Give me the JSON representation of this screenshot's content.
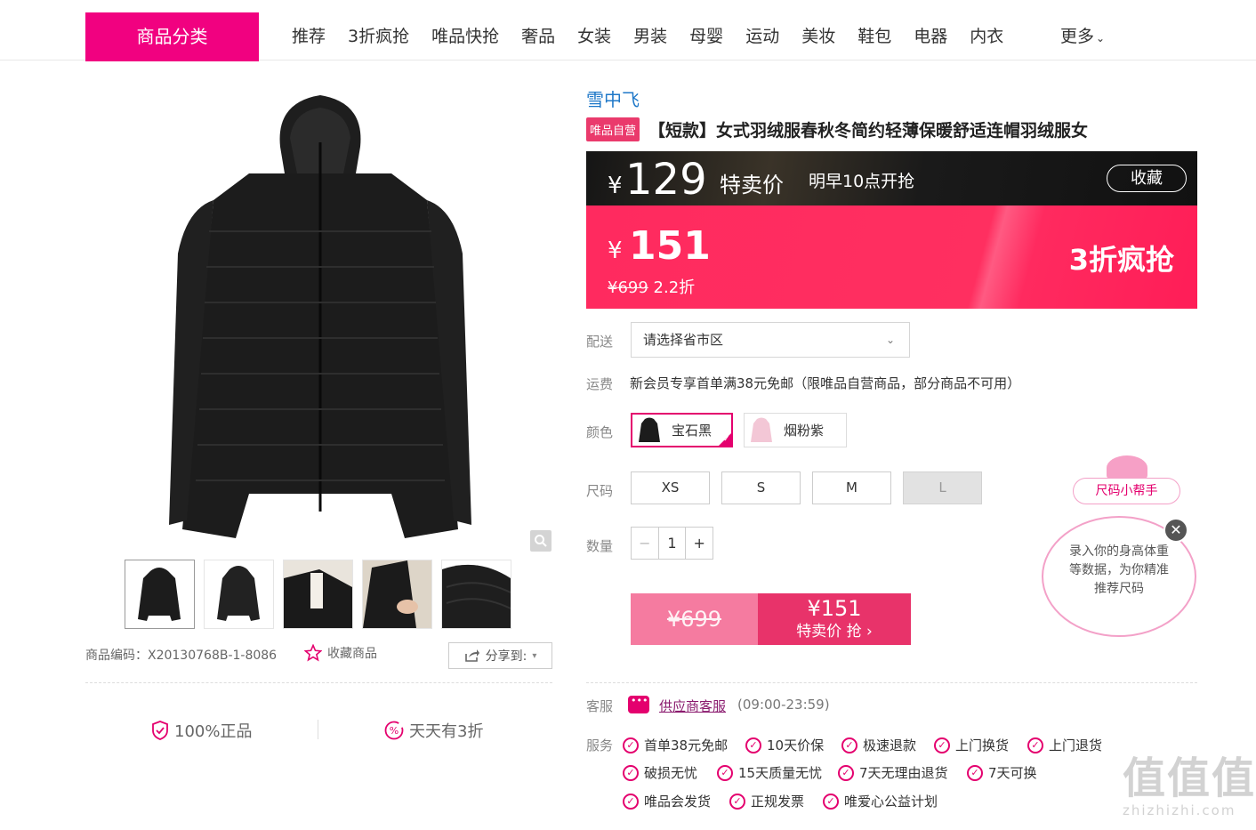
{
  "nav": {
    "category_button": "商品分类",
    "items": [
      "推荐",
      "3折疯抢",
      "唯品快抢",
      "奢品",
      "女装",
      "男装",
      "母婴",
      "运动",
      "美妆",
      "鞋包",
      "电器",
      "内衣"
    ],
    "more": "更多"
  },
  "product": {
    "brand": "雪中飞",
    "badge": "唯品自营",
    "title": "【短款】女式羽绒服春秋冬简约轻薄保暖舒适连帽羽绒服女",
    "code_label": "商品编码：X20130768B-1-8086",
    "favorite_label": "收藏商品",
    "share_label": "分享到:"
  },
  "guarantees": {
    "authentic": "100%正品",
    "daily_deal": "天天有3折"
  },
  "price_banner": {
    "yen": "¥",
    "special_price": "129",
    "special_label": "特卖价",
    "start_time": "明早10点开抢",
    "favorite_button": "收藏"
  },
  "price_pink": {
    "yen": "¥",
    "price": "151",
    "original_price": "¥699",
    "discount": "2.2折",
    "tag": "3折疯抢"
  },
  "delivery": {
    "label": "配送",
    "select_value": "请选择省市区"
  },
  "shipping": {
    "label": "运费",
    "text": "新会员专享首单满38元免邮（限唯品自营商品，部分商品不可用）"
  },
  "color": {
    "label": "颜色",
    "options": [
      "宝石黑",
      "烟粉紫"
    ]
  },
  "size": {
    "label": "尺码",
    "options": [
      "XS",
      "S",
      "M",
      "L"
    ]
  },
  "quantity": {
    "label": "数量",
    "minus": "−",
    "value": "1",
    "plus": "+"
  },
  "buy": {
    "original": "¥699",
    "price": "¥151",
    "action": "特卖价 抢"
  },
  "customer_service": {
    "label": "客服",
    "link": "供应商客服",
    "hours": "(09:00-23:59)"
  },
  "services": {
    "label": "服务",
    "items": [
      "首单38元免邮",
      "10天价保",
      "极速退款",
      "上门换货",
      "上门退货",
      "破损无忧",
      "15天质量无忧",
      "7天无理由退货",
      "7天可换",
      "唯品会发货",
      "正规发票",
      "唯爱心公益计划"
    ]
  },
  "size_helper": {
    "pill": "尺码小帮手",
    "text": "录入你的身高体重等数据，为你精准推荐尺码"
  },
  "watermark": {
    "big": "值值值",
    "small": "zhizhizhi.com"
  },
  "colors": {
    "accent": "#f10180",
    "price_pink": "#ff2a5f",
    "brand_link": "#1f78c8"
  }
}
